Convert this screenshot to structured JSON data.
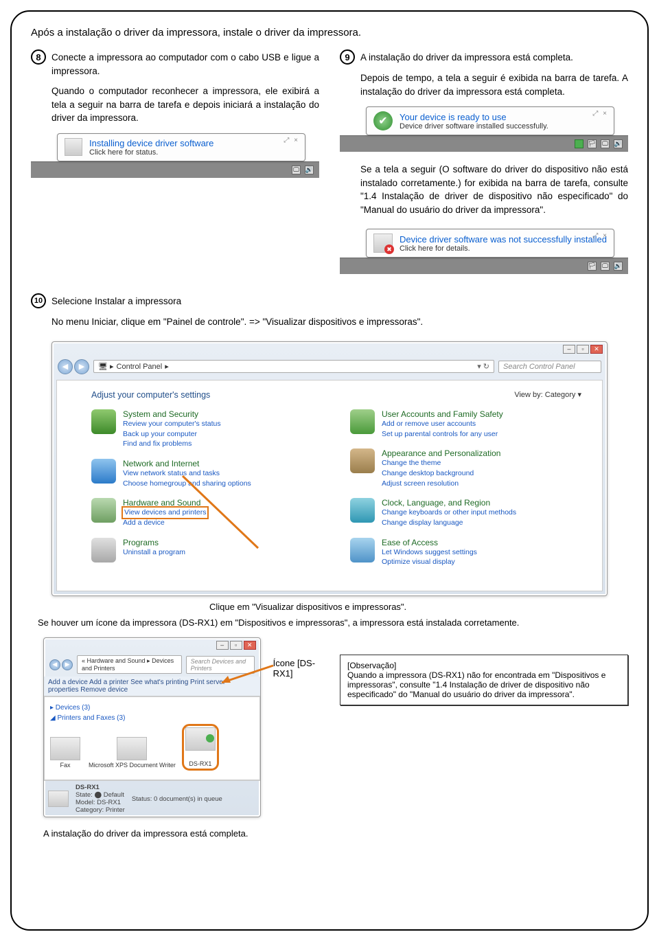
{
  "title": "Após a instalação o driver da impressora, instale o driver da impressora.",
  "step8": {
    "num": "8",
    "line1": "Conecte a impressora ao computador com o cabo USB e ligue a impressora.",
    "line2": "Quando o computador reconhecer a impressora, ele exibirá a tela a seguir na barra de tarefa e depois iniciará a instalação do driver da impressora."
  },
  "balloon_installing": {
    "title": "Installing device driver software",
    "sub": "Click here for status.",
    "close": "⤢ ×"
  },
  "step9": {
    "num": "9",
    "line1": "A instalação do driver da impressora está completa.",
    "line2": "Depois de tempo, a tela a seguir é exibida na barra de tarefa. A instalação do driver da impressora está completa."
  },
  "balloon_ready": {
    "title": "Your device is ready to use",
    "sub": "Device driver software installed successfully.",
    "close": "⤢ ×"
  },
  "step9b": "Se a tela a seguir (O software do driver do dispositivo não está instalado corretamente.) for exibida na barra de tarefa, consulte \"1.4 Instalação de driver de dispositivo não especificado\" do \"Manual do usuário do driver da impressora\".",
  "balloon_fail": {
    "title": "Device driver software was not successfully installed",
    "sub": "Click here for details.",
    "close": "⤢ ×"
  },
  "step10": {
    "num": "10",
    "title": "Selecione Instalar a impressora",
    "line": "No menu Iniciar, clique em \"Painel de controle\". => \"Visualizar dispositivos e impressoras\"."
  },
  "cp": {
    "addr": "Control Panel",
    "search": "Search Control Panel",
    "heading": "Adjust your computer's settings",
    "viewby": "View by:   Category ▾",
    "items_left": [
      {
        "head": "System and Security",
        "links": [
          "Review your computer's status",
          "Back up your computer",
          "Find and fix problems"
        ]
      },
      {
        "head": "Network and Internet",
        "links": [
          "View network status and tasks",
          "Choose homegroup and sharing options"
        ]
      },
      {
        "head": "Hardware and Sound",
        "links": [
          "View devices and printers",
          "Add a device"
        ]
      },
      {
        "head": "Programs",
        "links": [
          "Uninstall a program"
        ]
      }
    ],
    "items_right": [
      {
        "head": "User Accounts and Family Safety",
        "links": [
          "Add or remove user accounts",
          "Set up parental controls for any user"
        ]
      },
      {
        "head": "Appearance and Personalization",
        "links": [
          "Change the theme",
          "Change desktop background",
          "Adjust screen resolution"
        ]
      },
      {
        "head": "Clock, Language, and Region",
        "links": [
          "Change keyboards or other input methods",
          "Change display language"
        ]
      },
      {
        "head": "Ease of Access",
        "links": [
          "Let Windows suggest settings",
          "Optimize visual display"
        ]
      }
    ]
  },
  "caption_click": "Clique em \"Visualizar dispositivos e impressoras\".",
  "note_installed": "Se houver um ícone da impressora (DS-RX1) em \"Dispositivos e impressoras\", a impressora está instalada corretamente.",
  "devices": {
    "addr": "« Hardware and Sound ▸ Devices and Printers",
    "search": "Search Devices and Printers",
    "toolbar": "Add a device     Add a printer     See what's printing     Print server properties     Remove device",
    "sec1": "▸ Devices (3)",
    "sec2": "◢ Printers and Faxes (3)",
    "items": [
      {
        "label": "Fax"
      },
      {
        "label": "Microsoft XPS Document Writer"
      },
      {
        "label": "DS-RX1"
      }
    ],
    "status_name": "DS-RX1",
    "status_state": "State: ⬤ Default",
    "status_model": "Model: DS-RX1",
    "status_cat": "Category: Printer",
    "status_docs": "Status: 0 document(s) in queue"
  },
  "dsrx_label": "Ícone [DS-RX1]",
  "obs": {
    "title": "[Observação]",
    "body": "Quando a impressora (DS-RX1) não for encontrada em \"Dispositivos e impressoras\", consulte \"1.4 Instalação de driver de dispositivo não especificado\" do \"Manual do usuário do driver da impressora\"."
  },
  "final": "A instalação do driver da impressora está completa."
}
